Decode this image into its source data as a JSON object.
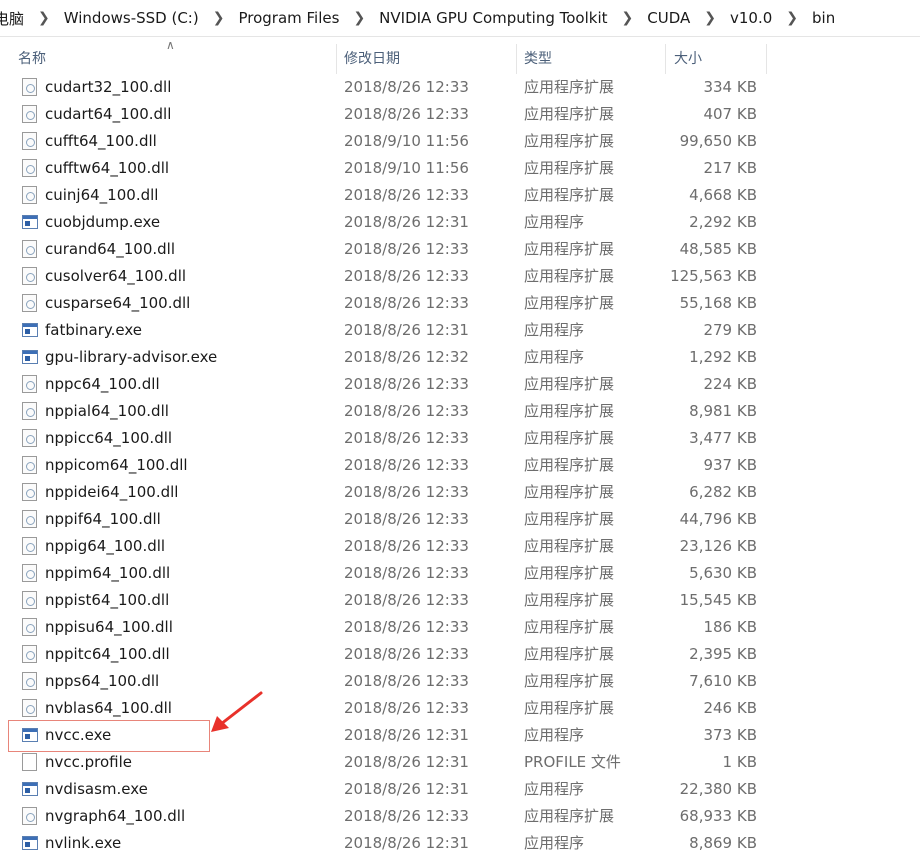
{
  "breadcrumb": [
    "电脑",
    "Windows-SSD (C:)",
    "Program Files",
    "NVIDIA GPU Computing Toolkit",
    "CUDA",
    "v10.0",
    "bin"
  ],
  "columns": {
    "name": "名称",
    "date": "修改日期",
    "type": "类型",
    "size": "大小"
  },
  "colors": {
    "header_text": "#4c607a",
    "secondary_text": "#6d6d6d",
    "annotation": "#e8312a"
  },
  "files": [
    {
      "name": "cudart32_100.dll",
      "date": "2018/8/26 12:33",
      "type": "应用程序扩展",
      "size": "334 KB",
      "icon": "dll-file-icon"
    },
    {
      "name": "cudart64_100.dll",
      "date": "2018/8/26 12:33",
      "type": "应用程序扩展",
      "size": "407 KB",
      "icon": "dll-file-icon"
    },
    {
      "name": "cufft64_100.dll",
      "date": "2018/9/10 11:56",
      "type": "应用程序扩展",
      "size": "99,650 KB",
      "icon": "dll-file-icon"
    },
    {
      "name": "cufftw64_100.dll",
      "date": "2018/9/10 11:56",
      "type": "应用程序扩展",
      "size": "217 KB",
      "icon": "dll-file-icon"
    },
    {
      "name": "cuinj64_100.dll",
      "date": "2018/8/26 12:33",
      "type": "应用程序扩展",
      "size": "4,668 KB",
      "icon": "dll-file-icon"
    },
    {
      "name": "cuobjdump.exe",
      "date": "2018/8/26 12:31",
      "type": "应用程序",
      "size": "2,292 KB",
      "icon": "exe-file-icon"
    },
    {
      "name": "curand64_100.dll",
      "date": "2018/8/26 12:33",
      "type": "应用程序扩展",
      "size": "48,585 KB",
      "icon": "dll-file-icon"
    },
    {
      "name": "cusolver64_100.dll",
      "date": "2018/8/26 12:33",
      "type": "应用程序扩展",
      "size": "125,563 KB",
      "icon": "dll-file-icon"
    },
    {
      "name": "cusparse64_100.dll",
      "date": "2018/8/26 12:33",
      "type": "应用程序扩展",
      "size": "55,168 KB",
      "icon": "dll-file-icon"
    },
    {
      "name": "fatbinary.exe",
      "date": "2018/8/26 12:31",
      "type": "应用程序",
      "size": "279 KB",
      "icon": "exe-file-icon"
    },
    {
      "name": "gpu-library-advisor.exe",
      "date": "2018/8/26 12:32",
      "type": "应用程序",
      "size": "1,292 KB",
      "icon": "exe-file-icon"
    },
    {
      "name": "nppc64_100.dll",
      "date": "2018/8/26 12:33",
      "type": "应用程序扩展",
      "size": "224 KB",
      "icon": "dll-file-icon"
    },
    {
      "name": "nppial64_100.dll",
      "date": "2018/8/26 12:33",
      "type": "应用程序扩展",
      "size": "8,981 KB",
      "icon": "dll-file-icon"
    },
    {
      "name": "nppicc64_100.dll",
      "date": "2018/8/26 12:33",
      "type": "应用程序扩展",
      "size": "3,477 KB",
      "icon": "dll-file-icon"
    },
    {
      "name": "nppicom64_100.dll",
      "date": "2018/8/26 12:33",
      "type": "应用程序扩展",
      "size": "937 KB",
      "icon": "dll-file-icon"
    },
    {
      "name": "nppidei64_100.dll",
      "date": "2018/8/26 12:33",
      "type": "应用程序扩展",
      "size": "6,282 KB",
      "icon": "dll-file-icon"
    },
    {
      "name": "nppif64_100.dll",
      "date": "2018/8/26 12:33",
      "type": "应用程序扩展",
      "size": "44,796 KB",
      "icon": "dll-file-icon"
    },
    {
      "name": "nppig64_100.dll",
      "date": "2018/8/26 12:33",
      "type": "应用程序扩展",
      "size": "23,126 KB",
      "icon": "dll-file-icon"
    },
    {
      "name": "nppim64_100.dll",
      "date": "2018/8/26 12:33",
      "type": "应用程序扩展",
      "size": "5,630 KB",
      "icon": "dll-file-icon"
    },
    {
      "name": "nppist64_100.dll",
      "date": "2018/8/26 12:33",
      "type": "应用程序扩展",
      "size": "15,545 KB",
      "icon": "dll-file-icon"
    },
    {
      "name": "nppisu64_100.dll",
      "date": "2018/8/26 12:33",
      "type": "应用程序扩展",
      "size": "186 KB",
      "icon": "dll-file-icon"
    },
    {
      "name": "nppitc64_100.dll",
      "date": "2018/8/26 12:33",
      "type": "应用程序扩展",
      "size": "2,395 KB",
      "icon": "dll-file-icon"
    },
    {
      "name": "npps64_100.dll",
      "date": "2018/8/26 12:33",
      "type": "应用程序扩展",
      "size": "7,610 KB",
      "icon": "dll-file-icon"
    },
    {
      "name": "nvblas64_100.dll",
      "date": "2018/8/26 12:33",
      "type": "应用程序扩展",
      "size": "246 KB",
      "icon": "dll-file-icon"
    },
    {
      "name": "nvcc.exe",
      "date": "2018/8/26 12:31",
      "type": "应用程序",
      "size": "373 KB",
      "icon": "exe-file-icon"
    },
    {
      "name": "nvcc.profile",
      "date": "2018/8/26 12:31",
      "type": "PROFILE 文件",
      "size": "1 KB",
      "icon": "generic-file-icon"
    },
    {
      "name": "nvdisasm.exe",
      "date": "2018/8/26 12:31",
      "type": "应用程序",
      "size": "22,380 KB",
      "icon": "exe-file-icon"
    },
    {
      "name": "nvgraph64_100.dll",
      "date": "2018/8/26 12:33",
      "type": "应用程序扩展",
      "size": "68,933 KB",
      "icon": "dll-file-icon"
    },
    {
      "name": "nvlink.exe",
      "date": "2018/8/26 12:31",
      "type": "应用程序",
      "size": "8,869 KB",
      "icon": "exe-file-icon"
    }
  ]
}
